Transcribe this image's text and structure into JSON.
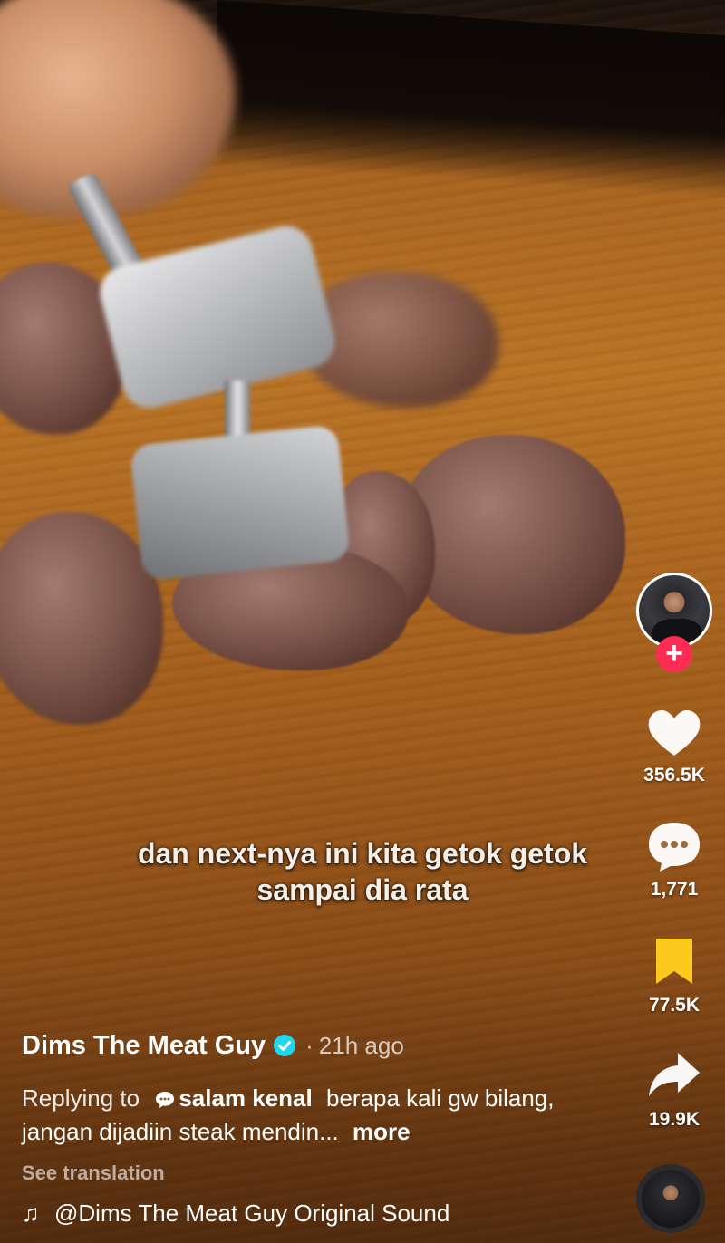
{
  "caption": {
    "line1": "dan next-nya ini kita getok getok",
    "line2": "sampai dia rata"
  },
  "actions": {
    "likes": "356.5K",
    "comments": "1,771",
    "saves": "77.5K",
    "shares": "19.9K"
  },
  "author": {
    "name": "Dims The Meat Guy",
    "separator": "·",
    "time_ago": "21h ago"
  },
  "description": {
    "reply_label": "Replying to",
    "reply_user": "salam kenal",
    "text": "berapa kali gw bilang, jangan dijadiin steak mendin...",
    "more_label": "more"
  },
  "see_translation": "See translation",
  "sound": {
    "label": "@Dims The Meat Guy Original Sound"
  },
  "colors": {
    "accent": "#fe2c55",
    "save_active": "#fcca1c",
    "verified": "#20d5ec"
  }
}
